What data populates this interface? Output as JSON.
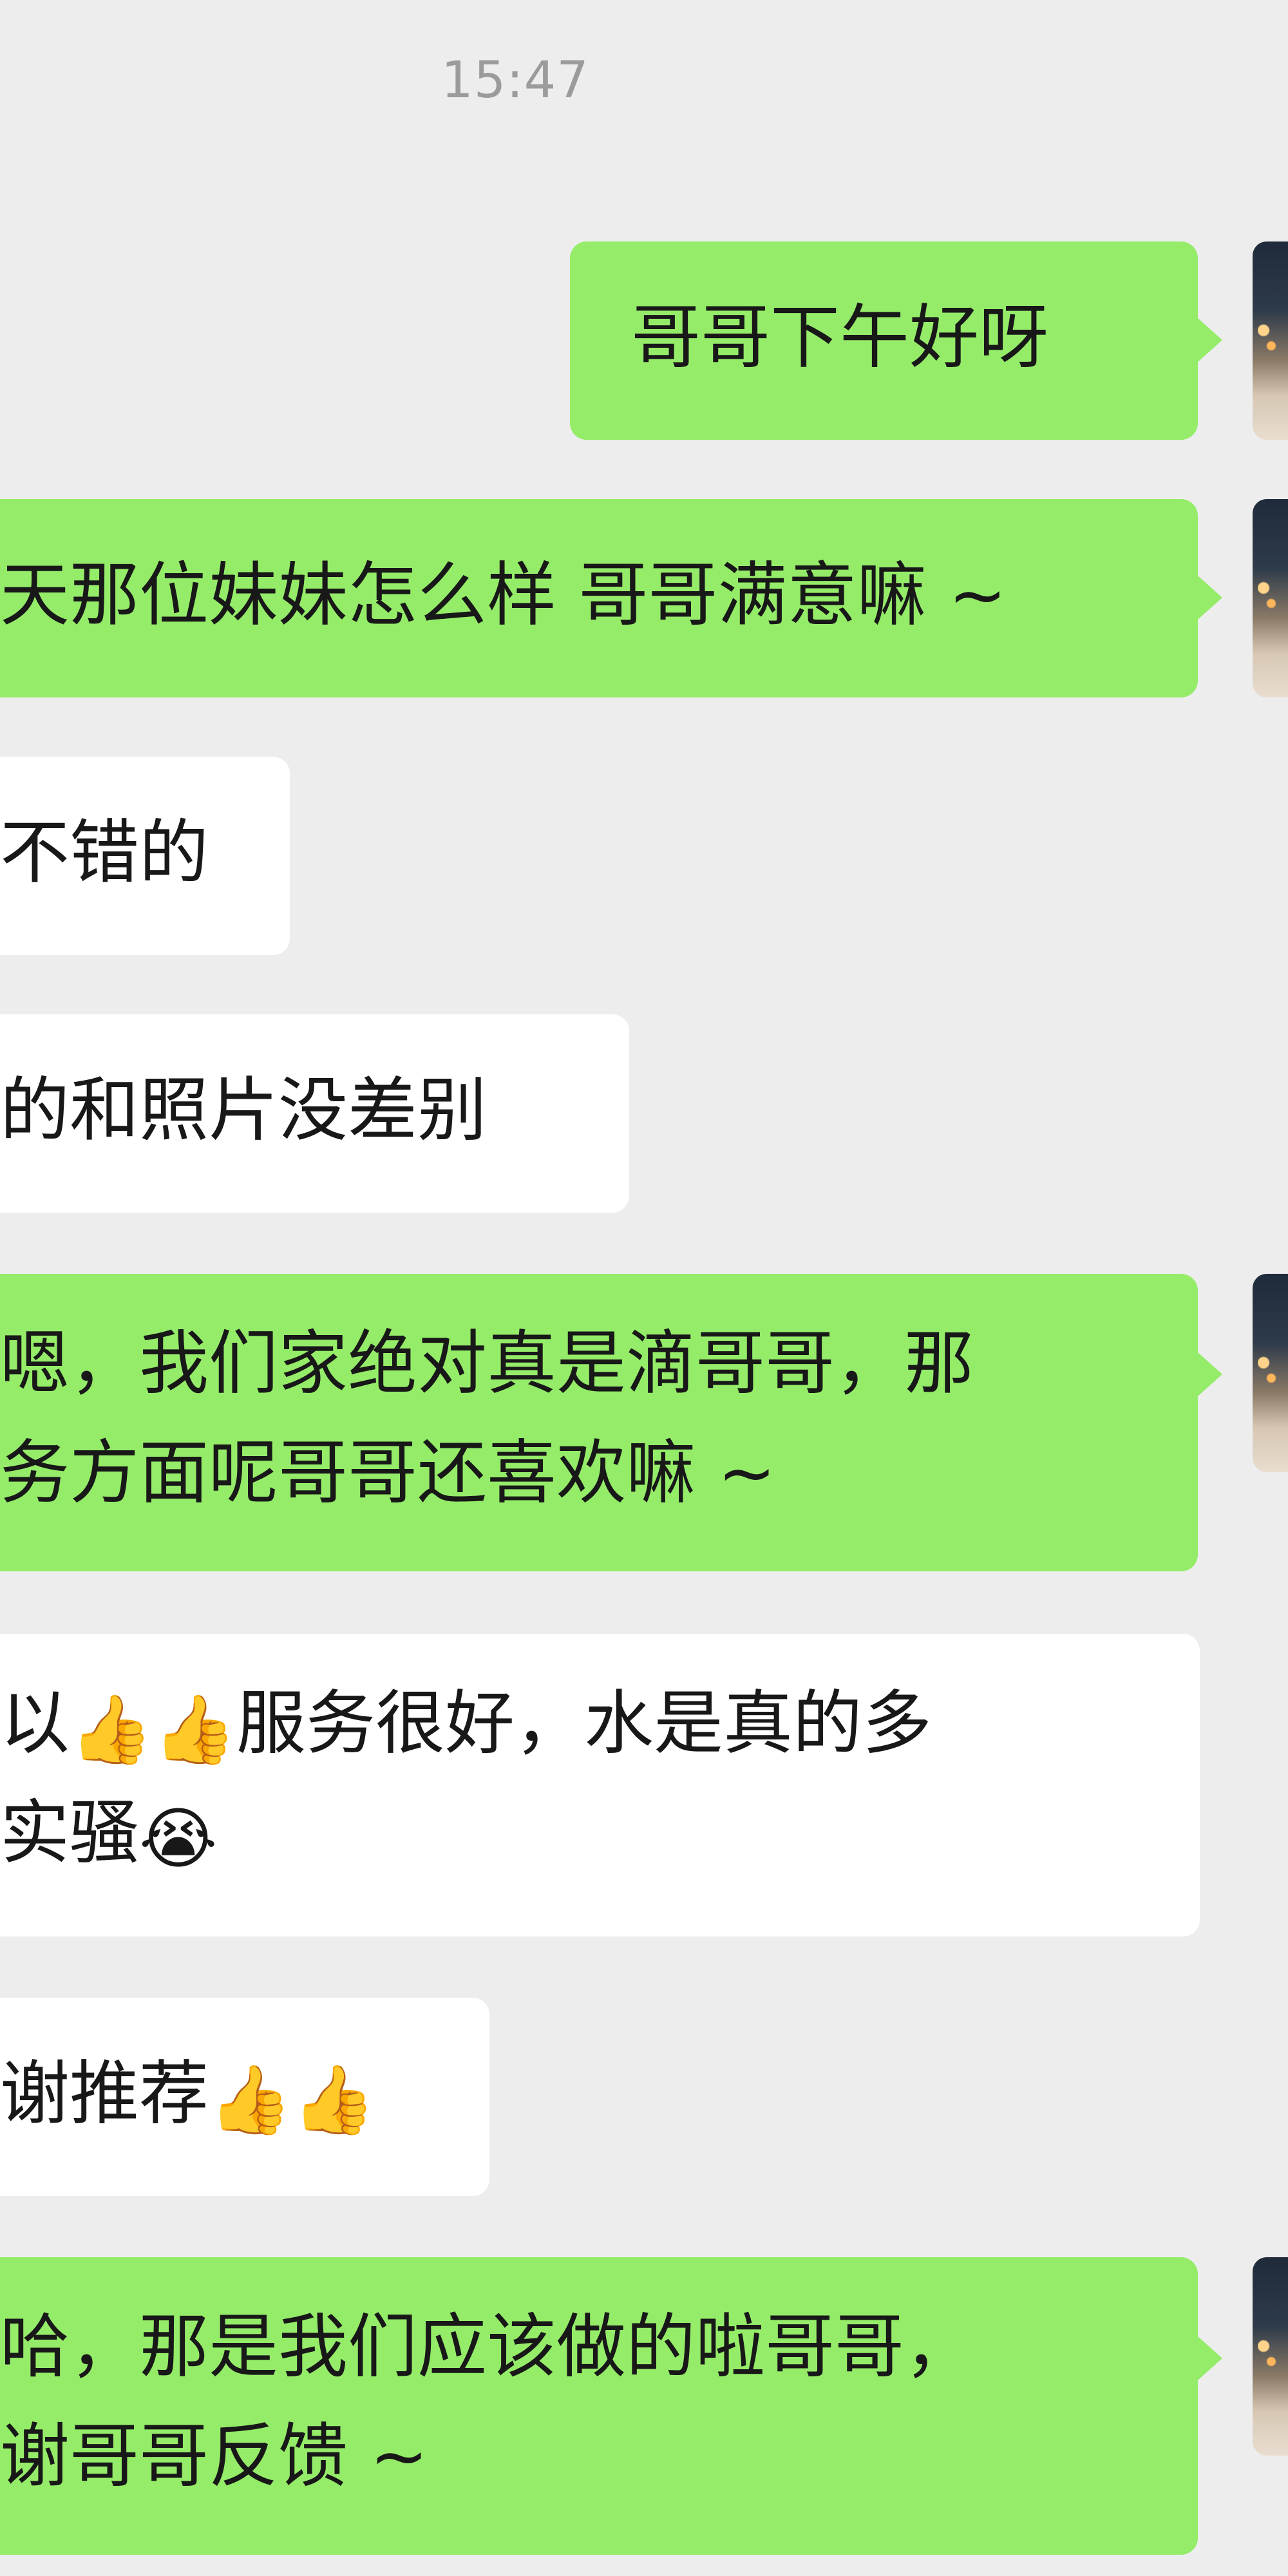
{
  "timestamp": "15:47",
  "messages": [
    {
      "side": "out",
      "lines": [
        "哥哥下午好呀"
      ]
    },
    {
      "side": "out",
      "lines": [
        "天那位妹妹怎么样 哥哥满意嘛 ~"
      ]
    },
    {
      "side": "in",
      "lines": [
        "不错的"
      ]
    },
    {
      "side": "in",
      "lines": [
        "的和照片没差别"
      ]
    },
    {
      "side": "out",
      "lines": [
        "嗯，我们家绝对真是滴哥哥，那",
        "务方面呢哥哥还喜欢嘛 ~"
      ]
    },
    {
      "side": "in",
      "lines": [
        "以",
        "👍",
        "👍",
        "服务很好，水是真的多",
        "实骚",
        "😭"
      ]
    },
    {
      "side": "in",
      "lines": [
        "谢推荐",
        "👍",
        "👍"
      ]
    },
    {
      "side": "out",
      "lines": [
        "哈，那是我们应该做的啦哥哥，",
        "谢哥哥反馈 ~"
      ]
    }
  ],
  "colors": {
    "background": "#ededed",
    "outgoing_bubble": "#95ec69",
    "incoming_bubble": "#ffffff",
    "timestamp_text": "#9b9b9b",
    "message_text": "#181818"
  },
  "icons": {
    "thumbs_up": "thumbs-up-emoji",
    "crying_laughing": "rolling-on-the-floor-laughing-emoji"
  }
}
